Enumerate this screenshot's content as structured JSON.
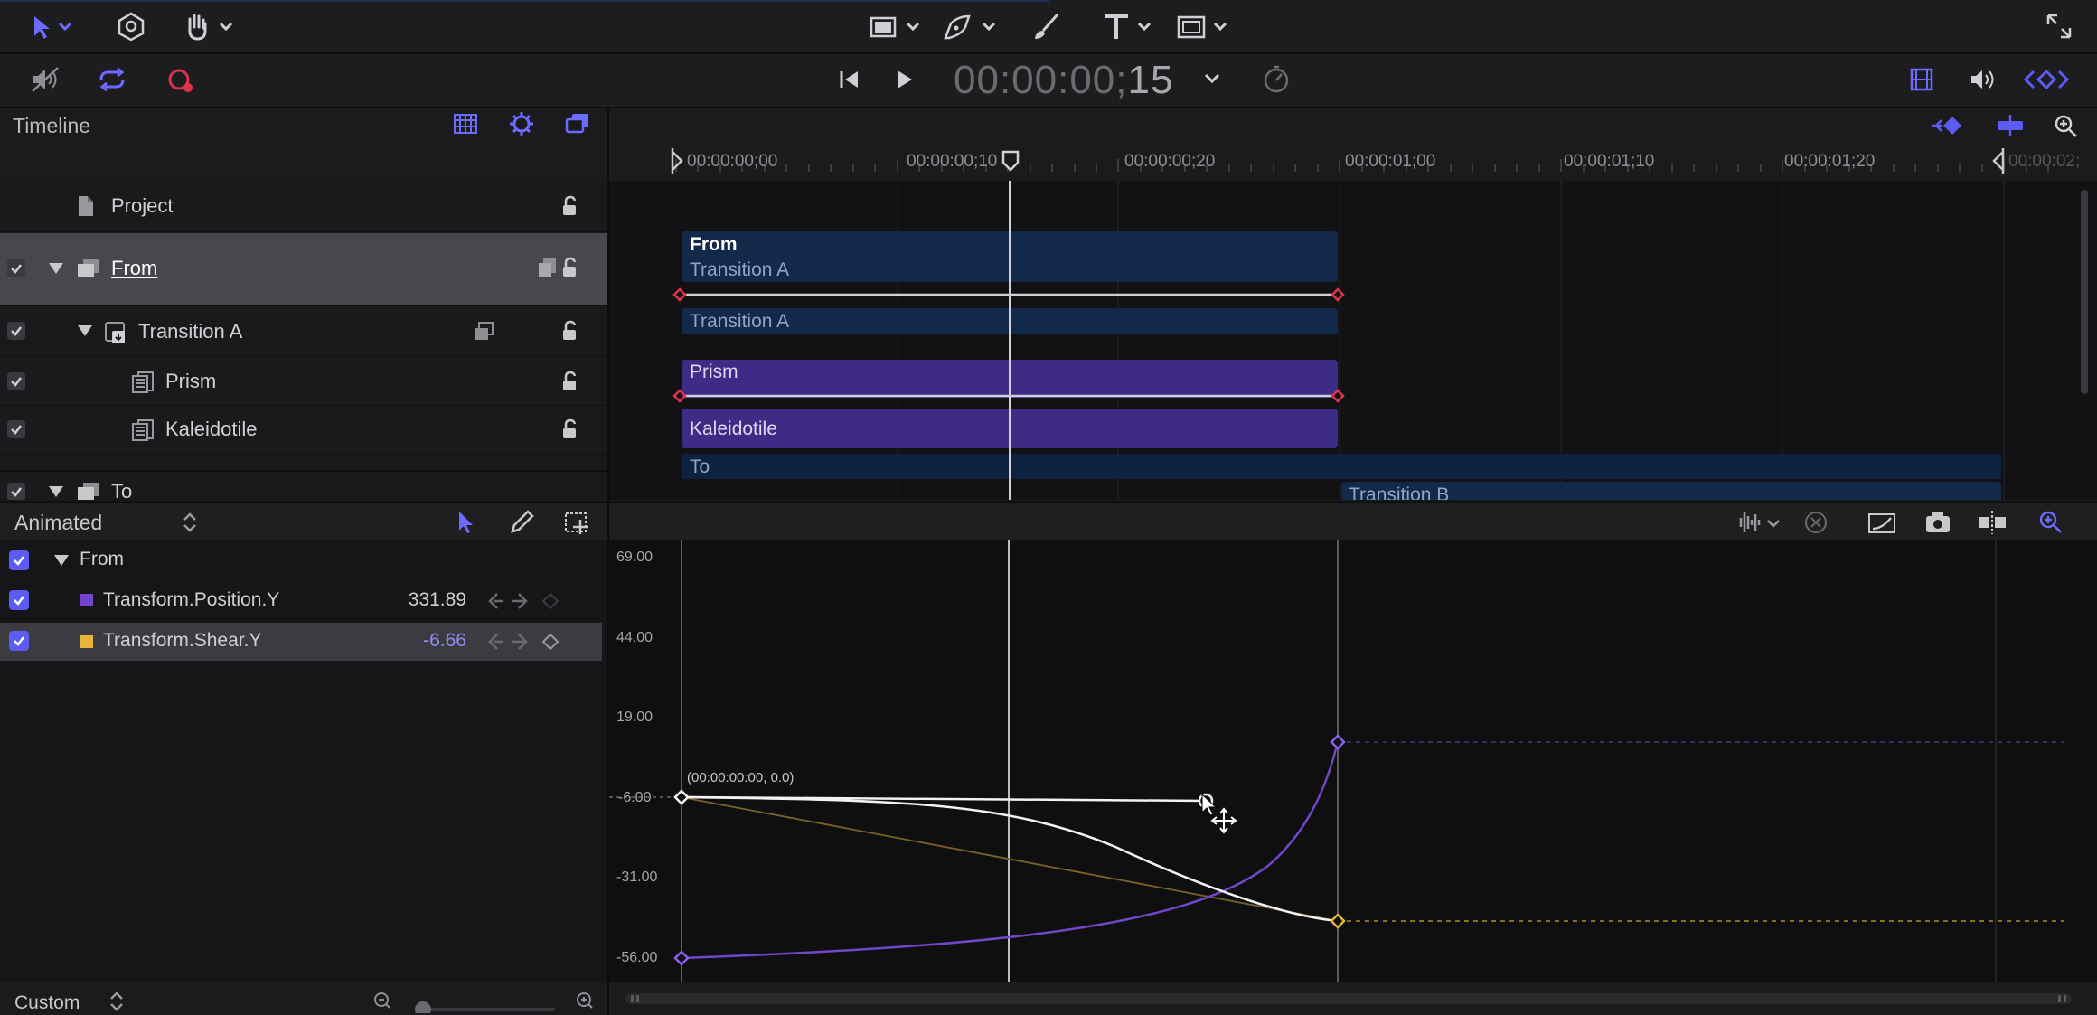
{
  "timecode": {
    "main": "00:00:00;",
    "frames": "15"
  },
  "timeline": {
    "title": "Timeline"
  },
  "ruler": {
    "ticks": [
      "00:00:00;00",
      "00:00:00;10",
      "00:00:00;20",
      "00:00:01;00",
      "00:00:01;10",
      "00:00:01;20",
      "00:00:02;"
    ]
  },
  "layers": [
    {
      "name": "Project"
    },
    {
      "name": "From"
    },
    {
      "name": "Transition A"
    },
    {
      "name": "Prism"
    },
    {
      "name": "Kaleidotile"
    },
    {
      "name": "To"
    }
  ],
  "clips": {
    "from": {
      "title": "From",
      "subtitle": "Transition A"
    },
    "transition_a": "Transition A",
    "prism": "Prism",
    "kaleidotile": "Kaleidotile",
    "to": "To",
    "transition_b": "Transition B"
  },
  "curve_editor": {
    "filter": "Animated",
    "group": "From",
    "params": [
      {
        "name": "Transform.Position.Y",
        "value": "331.89",
        "color": "#7146c9"
      },
      {
        "name": "Transform.Shear.Y",
        "value": "-6.66",
        "color": "#e7b53a"
      }
    ],
    "y_labels": [
      "69.00",
      "44.00",
      "19.00",
      "-6.00",
      "-31.00",
      "-56.00"
    ],
    "keyframe_tooltip": "(00:00:00:00, 0.0)",
    "zoom_mode": "Custom"
  },
  "colors": {
    "accent": "#5c5cf5",
    "clip_dark": "#12294a",
    "clip_purple": "#3e2b86",
    "keyframe_red": "#e0334a",
    "position_curve": "#7146c9",
    "shear_curve": "#e7b53a"
  },
  "icons": [
    "select-arrow-icon",
    "transform-icon",
    "hand-icon",
    "rectangle-icon",
    "pen-icon",
    "paint-brush-icon",
    "text-icon",
    "frame-mask-icon",
    "fullscreen-icon",
    "mute-icon",
    "loop-icon",
    "record-icon",
    "skip-back-icon",
    "play-icon",
    "timer-icon",
    "film-icon",
    "volume-icon",
    "keyframe-nav-icon",
    "checkerboard-icon",
    "gear-icon",
    "layers-icon",
    "keyframe-add-icon",
    "snap-icon",
    "zoom-icon",
    "audio-waveform-icon",
    "clear-icon",
    "fit-icon",
    "snapshot-icon",
    "split-icon",
    "pencil-icon",
    "marquee-icon",
    "lock-icon"
  ]
}
